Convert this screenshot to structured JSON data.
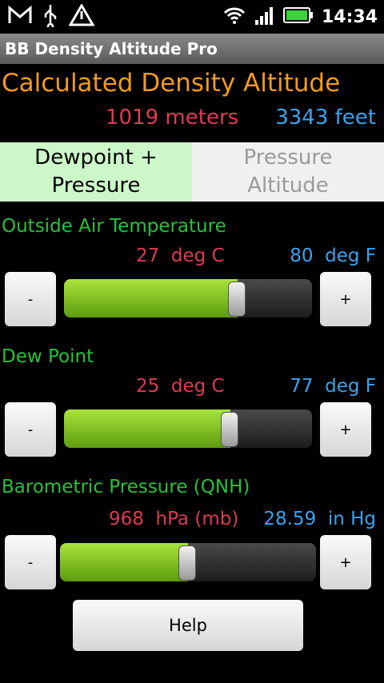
{
  "status_bar": {
    "time": "14:34",
    "icons": [
      "gmail-icon",
      "usb-icon",
      "warning-icon",
      "wifi-icon",
      "signal-icon",
      "battery-icon"
    ]
  },
  "app": {
    "title": "BB Density Altitude Pro"
  },
  "result": {
    "heading": "Calculated Density Altitude",
    "meters": "1019 meters",
    "feet": "3343 feet"
  },
  "tabs": {
    "dewpoint": "Dewpoint +\nPressure",
    "pressure": "Pressure\nAltitude",
    "active": "dewpoint"
  },
  "sections": [
    {
      "label": "Outside Air Temperature",
      "value_left": "27  deg C",
      "value_right": "80  deg F",
      "slider_fraction": 0.7
    },
    {
      "label": "Dew Point",
      "value_left": "25  deg C",
      "value_right": "77  deg F",
      "slider_fraction": 0.67
    },
    {
      "label": "Barometric Pressure (QNH)",
      "value_left": "968  hPa (mb)",
      "value_right": "28.59  in Hg",
      "slider_fraction": 0.5
    }
  ],
  "buttons": {
    "minus": "-",
    "plus": "+",
    "help": "Help"
  },
  "colors": {
    "orange": "#f39a1e",
    "red": "#e03a52",
    "blue": "#3aa4f0",
    "green": "#27c23c"
  }
}
